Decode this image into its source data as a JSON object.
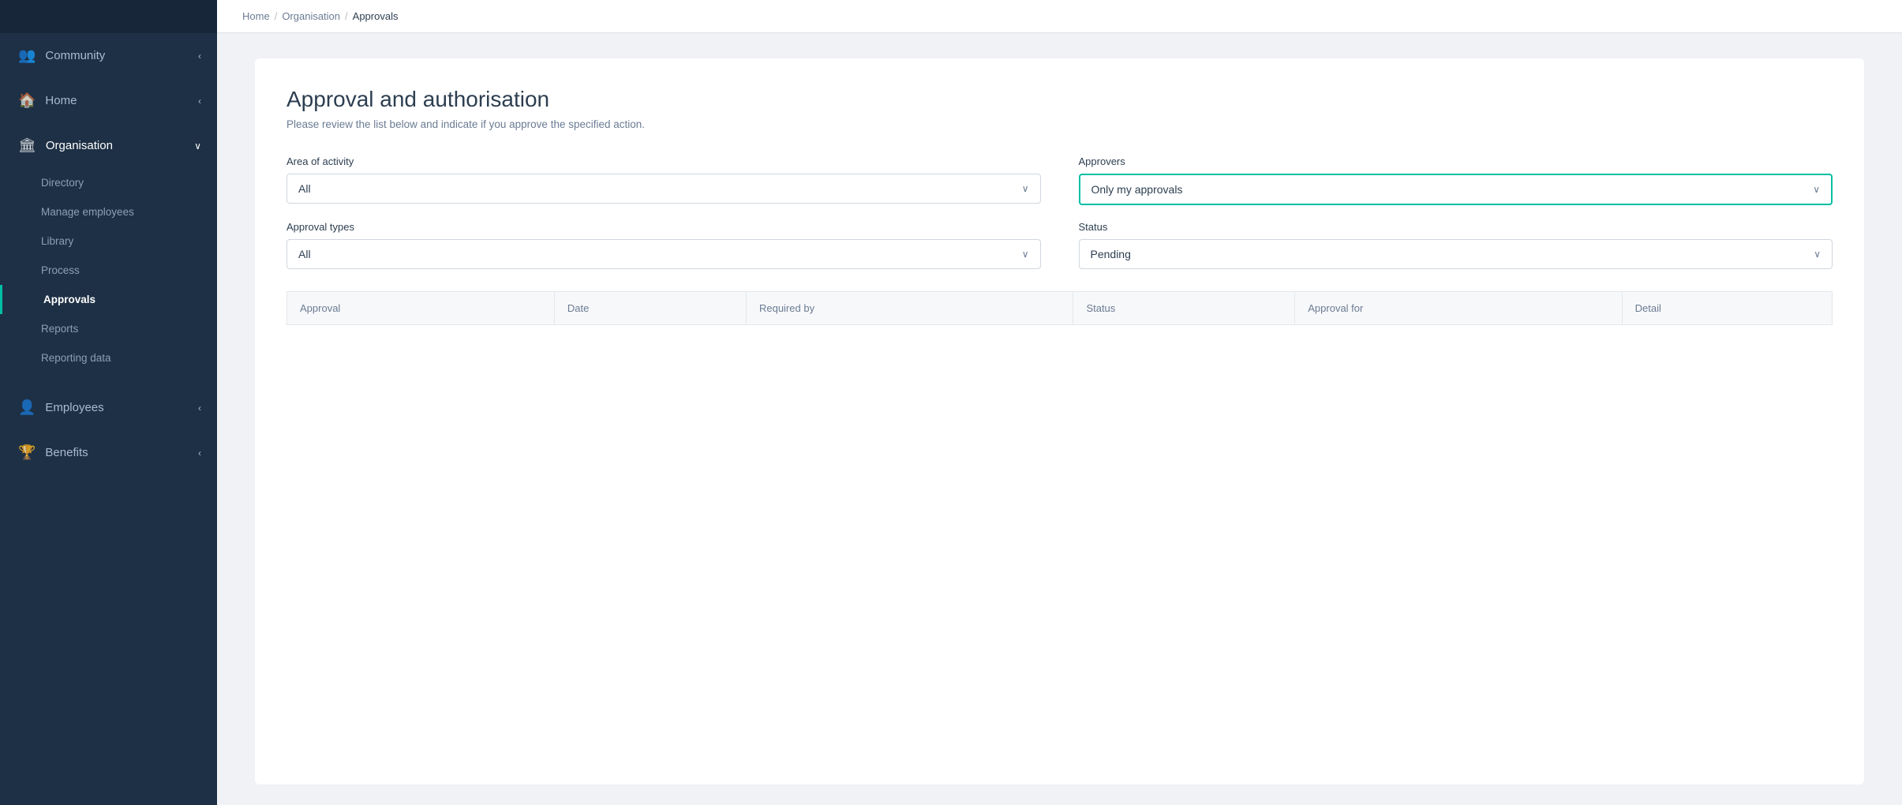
{
  "sidebar": {
    "items": [
      {
        "id": "community",
        "label": "Community",
        "icon": "👥",
        "chevron": "‹",
        "active": false
      },
      {
        "id": "home",
        "label": "Home",
        "icon": "🏠",
        "chevron": "‹",
        "active": false
      },
      {
        "id": "organisation",
        "label": "Organisation",
        "icon": "🏛",
        "chevron": "∨",
        "active": true
      }
    ],
    "sub_items": [
      {
        "id": "directory",
        "label": "Directory",
        "active": false
      },
      {
        "id": "manage-employees",
        "label": "Manage employees",
        "active": false
      },
      {
        "id": "library",
        "label": "Library",
        "active": false
      },
      {
        "id": "process",
        "label": "Process",
        "active": false
      },
      {
        "id": "approvals",
        "label": "Approvals",
        "active": true
      },
      {
        "id": "reports",
        "label": "Reports",
        "active": false
      },
      {
        "id": "reporting-data",
        "label": "Reporting data",
        "active": false
      }
    ],
    "bottom_items": [
      {
        "id": "employees",
        "label": "Employees",
        "icon": "👤",
        "chevron": "‹",
        "active": false
      },
      {
        "id": "benefits",
        "label": "Benefits",
        "icon": "🏆",
        "chevron": "‹",
        "active": false
      }
    ]
  },
  "breadcrumb": {
    "home": "Home",
    "org": "Organisation",
    "current": "Approvals"
  },
  "page": {
    "title": "Approval and authorisation",
    "subtitle": "Please review the list below and indicate if you approve the specified action."
  },
  "filters": {
    "area_label": "Area of activity",
    "area_value": "All",
    "types_label": "Approval types",
    "types_value": "All",
    "approvers_label": "Approvers",
    "approvers_value": "Only my approvals",
    "status_label": "Status",
    "status_value": "Pending"
  },
  "table": {
    "columns": [
      "Approval",
      "Date",
      "Required by",
      "Status",
      "Approval for",
      "Detail"
    ]
  }
}
